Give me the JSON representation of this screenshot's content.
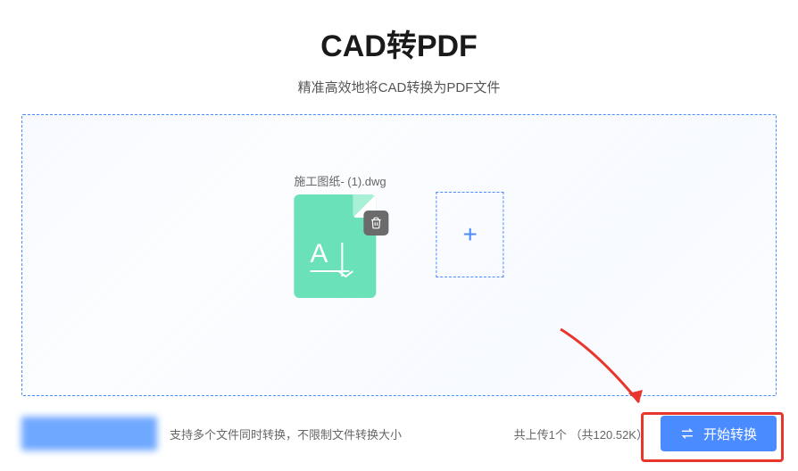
{
  "header": {
    "title": "CAD转PDF",
    "subtitle": "精准高效地将CAD转换为PDF文件"
  },
  "file": {
    "name": "施工图纸- (1).dwg"
  },
  "footer": {
    "support_text": "支持多个文件同时转换，不限制文件转换大小",
    "uploaded_prefix": "共上传",
    "uploaded_count": "1",
    "uploaded_unit": "个",
    "size_open": "（共",
    "size_value": "120.52K",
    "size_close": "）",
    "convert_label": "开始转换"
  }
}
